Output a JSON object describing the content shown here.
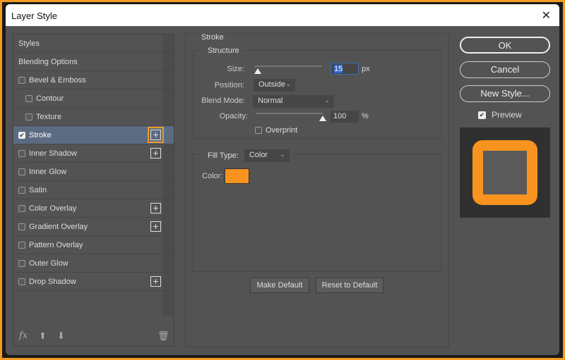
{
  "dialog": {
    "title": "Layer Style"
  },
  "sidebar": {
    "items": [
      {
        "label": "Styles",
        "checkbox": false,
        "plus": false
      },
      {
        "label": "Blending Options",
        "checkbox": false,
        "plus": false
      },
      {
        "label": "Bevel & Emboss",
        "checkbox": true,
        "checked": false,
        "plus": false
      },
      {
        "label": "Contour",
        "checkbox": true,
        "checked": false,
        "plus": false,
        "indent": true
      },
      {
        "label": "Texture",
        "checkbox": true,
        "checked": false,
        "plus": false,
        "indent": true
      },
      {
        "label": "Stroke",
        "checkbox": true,
        "checked": true,
        "plus": true,
        "selected": true
      },
      {
        "label": "Inner Shadow",
        "checkbox": true,
        "checked": false,
        "plus": true
      },
      {
        "label": "Inner Glow",
        "checkbox": true,
        "checked": false,
        "plus": false
      },
      {
        "label": "Satin",
        "checkbox": true,
        "checked": false,
        "plus": false
      },
      {
        "label": "Color Overlay",
        "checkbox": true,
        "checked": false,
        "plus": true
      },
      {
        "label": "Gradient Overlay",
        "checkbox": true,
        "checked": false,
        "plus": true
      },
      {
        "label": "Pattern Overlay",
        "checkbox": true,
        "checked": false,
        "plus": false
      },
      {
        "label": "Outer Glow",
        "checkbox": true,
        "checked": false,
        "plus": false
      },
      {
        "label": "Drop Shadow",
        "checkbox": true,
        "checked": false,
        "plus": true
      }
    ],
    "footer": {
      "fx": "fx"
    }
  },
  "stroke": {
    "title": "Stroke",
    "structure_title": "Structure",
    "size_label": "Size:",
    "size_value": "15",
    "size_unit": "px",
    "size_fraction": 0.05,
    "position_label": "Position:",
    "position_value": "Outside",
    "blend_label": "Blend Mode:",
    "blend_value": "Normal",
    "opacity_label": "Opacity:",
    "opacity_value": "100",
    "opacity_unit": "%",
    "opacity_fraction": 1.0,
    "overprint_label": "Overprint",
    "filltype_label": "Fill Type:",
    "filltype_value": "Color",
    "color_label": "Color:",
    "color": "#f7931e",
    "make_default": "Make Default",
    "reset_default": "Reset to Default"
  },
  "right": {
    "ok": "OK",
    "cancel": "Cancel",
    "new_style": "New Style...",
    "preview_label": "Preview",
    "preview_checked": true
  }
}
